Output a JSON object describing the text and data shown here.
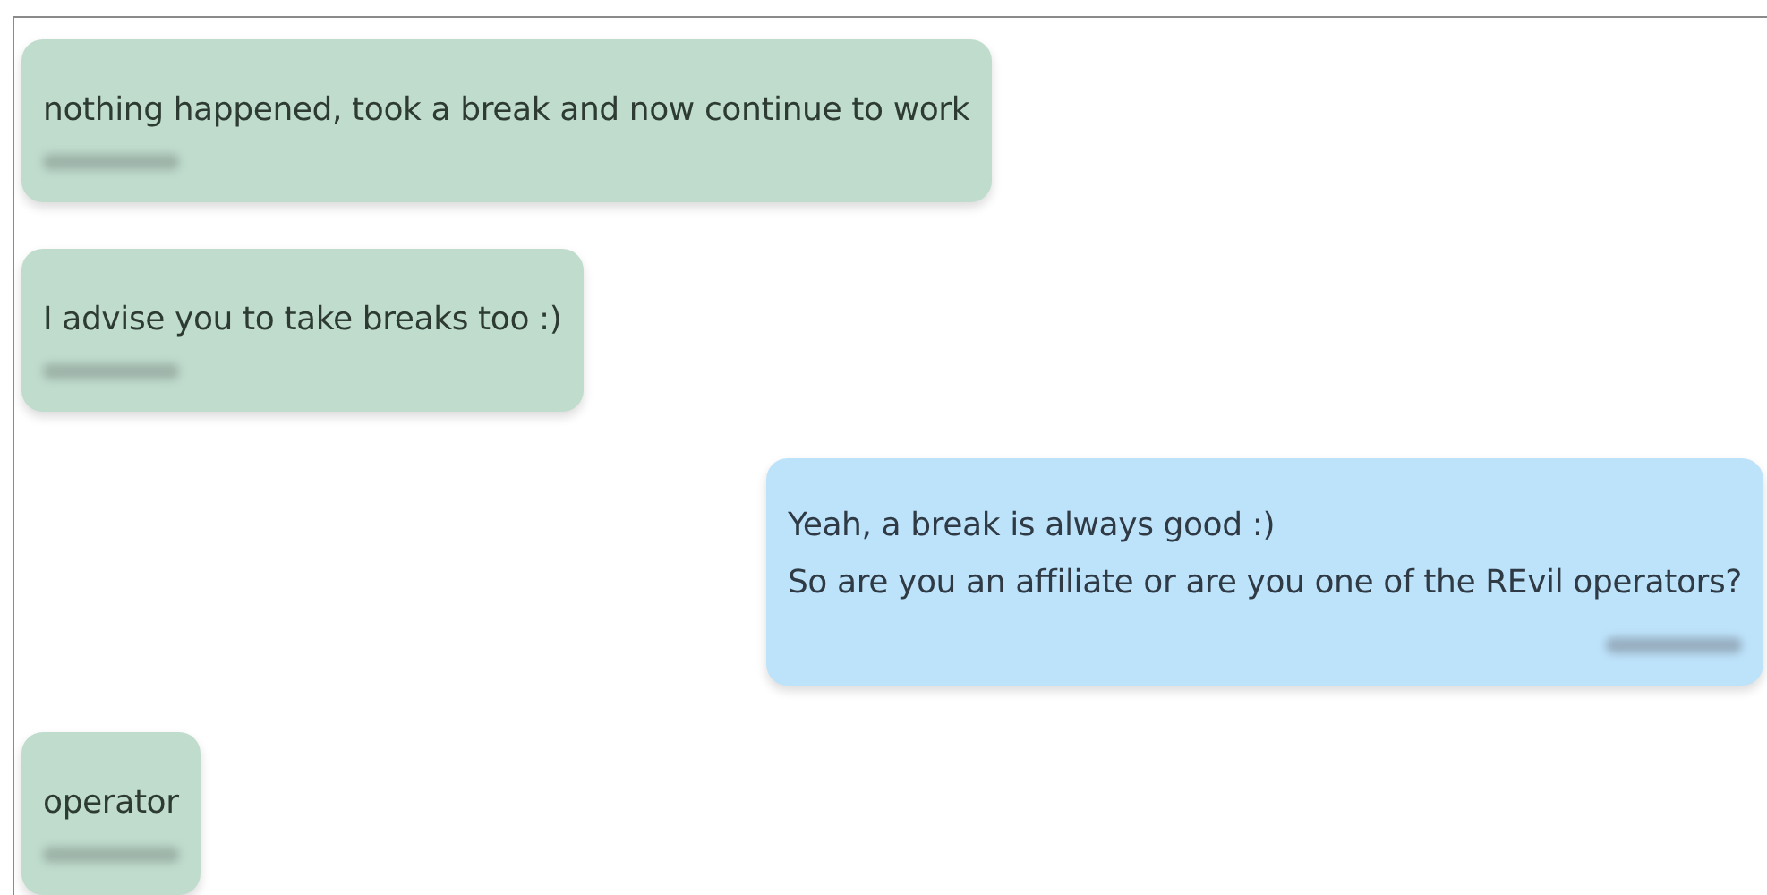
{
  "messages": [
    {
      "kind": "them",
      "lines": [
        "nothing happened, took a break and now continue to work"
      ],
      "redacted_timestamp": true
    },
    {
      "kind": "them",
      "lines": [
        "I advise you to take breaks too :)"
      ],
      "redacted_timestamp": true
    },
    {
      "kind": "me",
      "lines": [
        "Yeah, a break is always good :)",
        "So are you an affiliate or are you one of the REvil operators?"
      ],
      "redacted_timestamp": true
    },
    {
      "kind": "them",
      "lines": [
        "operator"
      ],
      "redacted_timestamp": true
    }
  ]
}
